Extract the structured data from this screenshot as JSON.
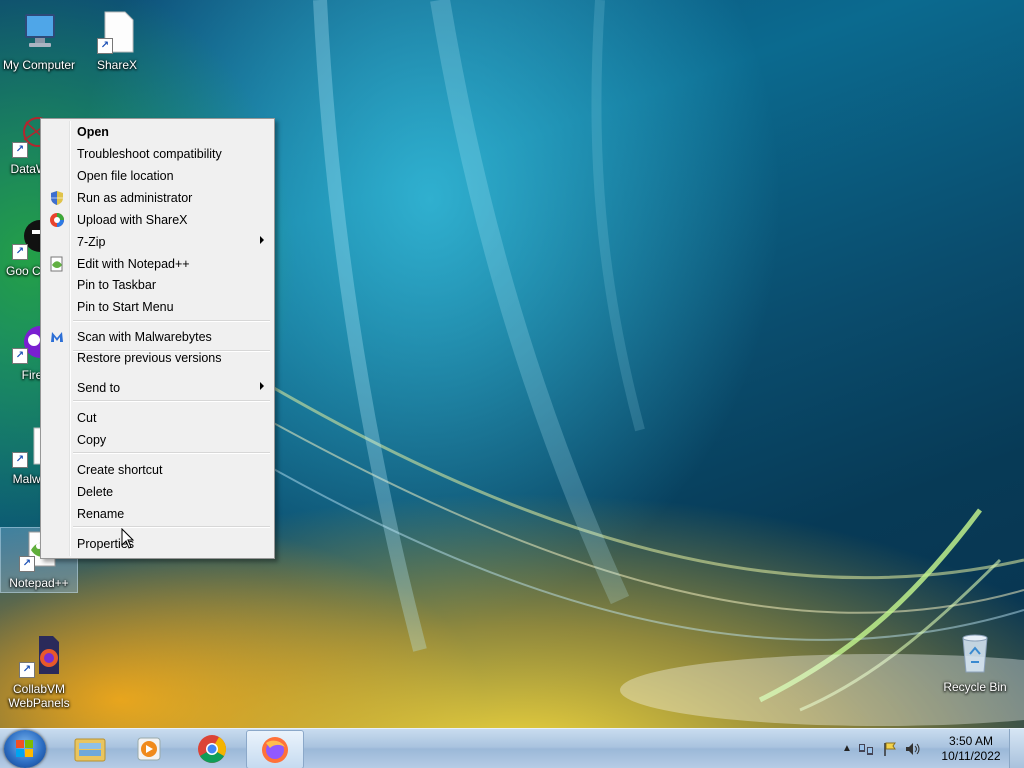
{
  "desktop": {
    "icons": [
      {
        "label": "My Computer"
      },
      {
        "label": "ShareX"
      },
      {
        "label": "DataWa"
      },
      {
        "label": "Goo Chro"
      },
      {
        "label": "Fire"
      },
      {
        "label": "Malwar"
      },
      {
        "label": "Notepad++"
      },
      {
        "label": "CollabVM WebPanels"
      },
      {
        "label": "Recycle Bin"
      }
    ]
  },
  "context_menu": {
    "items": [
      {
        "label": "Open",
        "bold": true
      },
      {
        "label": "Troubleshoot compatibility"
      },
      {
        "label": "Open file location"
      },
      {
        "label": "Run as administrator",
        "icon": "shield-icon"
      },
      {
        "label": "Upload with ShareX",
        "icon": "sharex-icon"
      },
      {
        "label": "7-Zip",
        "submenu": true
      },
      {
        "label": "Edit with Notepad++",
        "icon": "notepadpp-icon"
      },
      {
        "label": "Pin to Taskbar"
      },
      {
        "label": "Pin to Start Menu"
      },
      {
        "label": "Scan with Malwarebytes",
        "icon": "malwarebytes-icon"
      },
      {
        "label": "Restore previous versions"
      },
      {
        "label": "Send to",
        "submenu": true
      },
      {
        "label": "Cut"
      },
      {
        "label": "Copy"
      },
      {
        "label": "Create shortcut"
      },
      {
        "label": "Delete"
      },
      {
        "label": "Rename"
      },
      {
        "label": "Properties"
      }
    ]
  },
  "taskbar": {
    "pinned": [
      {
        "name": "start-button"
      },
      {
        "name": "explorer-icon"
      },
      {
        "name": "media-player-icon"
      },
      {
        "name": "chrome-icon"
      },
      {
        "name": "firefox-icon"
      }
    ],
    "clock": {
      "time": "3:50 AM",
      "date": "10/11/2022"
    }
  },
  "colors": {
    "menu_bg": "#f0f0f0",
    "taskbar": "#a9c3df"
  }
}
